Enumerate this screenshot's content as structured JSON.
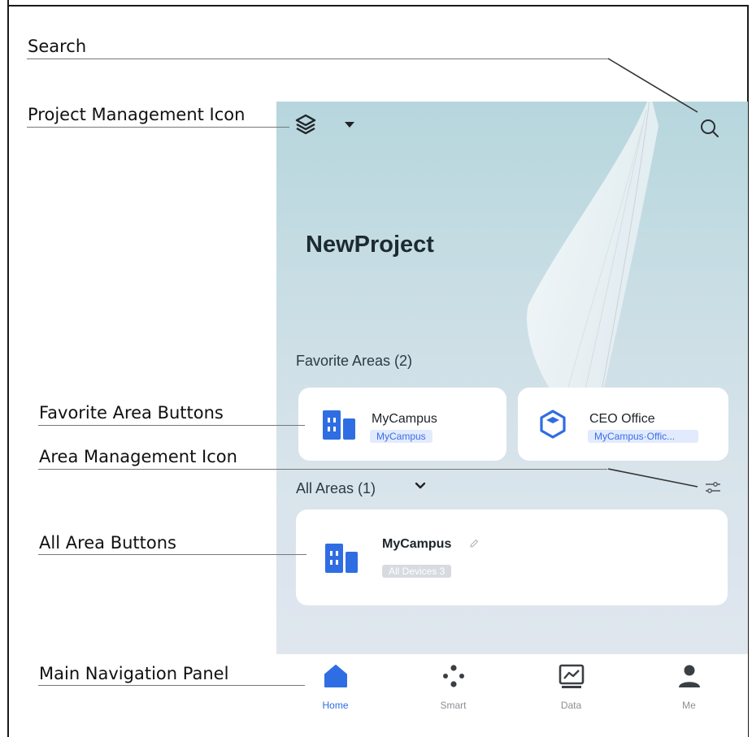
{
  "annotations": {
    "search": "Search",
    "project_management_icon": "Project Management Icon",
    "favorite_area_buttons": "Favorite Area Buttons",
    "area_management_icon": "Area Management Icon",
    "all_area_buttons": "All Area Buttons",
    "main_navigation_panel": "Main Navigation Panel"
  },
  "app": {
    "project_name": "NewProject",
    "favorite_areas": {
      "heading": "Favorite Areas (2)",
      "items": [
        {
          "name": "MyCampus",
          "tag": "MyCampus",
          "icon": "building-icon"
        },
        {
          "name": "CEO Office",
          "tag": "MyCampus·Offic...",
          "icon": "room-cube-icon"
        }
      ]
    },
    "all_areas": {
      "heading": "All Areas (1)",
      "items": [
        {
          "name": "MyCampus",
          "tag": "All Devices 3",
          "icon": "building-icon"
        }
      ]
    },
    "nav": [
      {
        "label": "Home",
        "icon": "home-icon",
        "active": true
      },
      {
        "label": "Smart",
        "icon": "smart-dots-icon",
        "active": false
      },
      {
        "label": "Data",
        "icon": "chart-icon",
        "active": false
      },
      {
        "label": "Me",
        "icon": "person-icon",
        "active": false
      }
    ]
  },
  "colors": {
    "accent": "#2f6de3",
    "tag_bg": "#e2ebfd",
    "muted_tag_bg": "#d7dbe0"
  }
}
